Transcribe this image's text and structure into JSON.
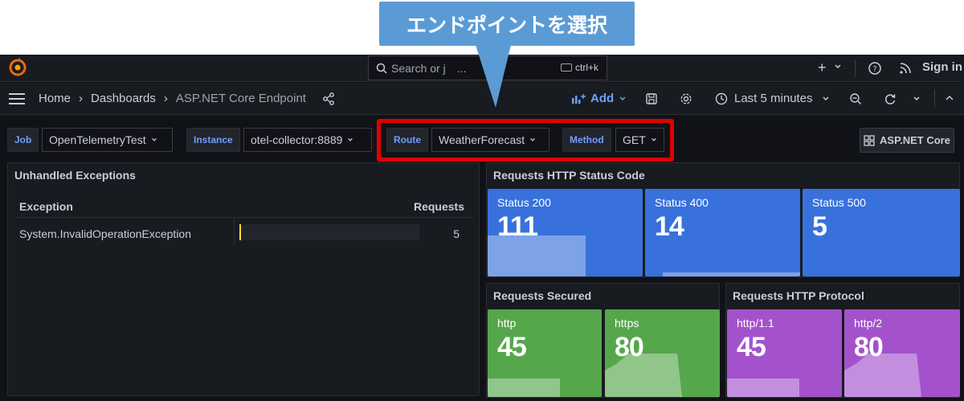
{
  "callout": {
    "text": "エンドポイントを選択"
  },
  "topnav": {
    "search_placeholder": "Search or j",
    "search_ellipsis": "...",
    "shortcut": "ctrl+k",
    "plus": "+",
    "signin": "Sign in"
  },
  "toolbar": {
    "breadcrumbs": [
      "Home",
      "Dashboards",
      "ASP.NET Core Endpoint"
    ],
    "add_label": "Add",
    "time_range": "Last 5 minutes"
  },
  "variables": [
    {
      "label": "Job",
      "value": "OpenTelemetryTest"
    },
    {
      "label": "Instance",
      "value": "otel-collector:8889"
    },
    {
      "label": "Route",
      "value": "WeatherForecast"
    },
    {
      "label": "Method",
      "value": "GET"
    }
  ],
  "aspnet_link": "ASP.NET Core",
  "panels": {
    "exceptions": {
      "title": "Unhandled Exceptions",
      "columns": [
        "Exception",
        "Requests"
      ],
      "rows": [
        {
          "exception": "System.InvalidOperationException",
          "requests": "5"
        }
      ]
    },
    "status": {
      "title": "Requests HTTP Status Code",
      "stats": [
        {
          "label": "Status 200",
          "value": "111",
          "color": "#3871dc"
        },
        {
          "label": "Status 400",
          "value": "14",
          "color": "#3871dc"
        },
        {
          "label": "Status 500",
          "value": "5",
          "color": "#3871dc"
        }
      ]
    },
    "secured": {
      "title": "Requests Secured",
      "stats": [
        {
          "label": "http",
          "value": "45",
          "color": "#56a64b"
        },
        {
          "label": "https",
          "value": "80",
          "color": "#56a64b"
        }
      ]
    },
    "protocol": {
      "title": "Requests HTTP Protocol",
      "stats": [
        {
          "label": "http/1.1",
          "value": "45",
          "color": "#a352cc"
        },
        {
          "label": "http/2",
          "value": "80",
          "color": "#a352cc"
        }
      ]
    }
  }
}
